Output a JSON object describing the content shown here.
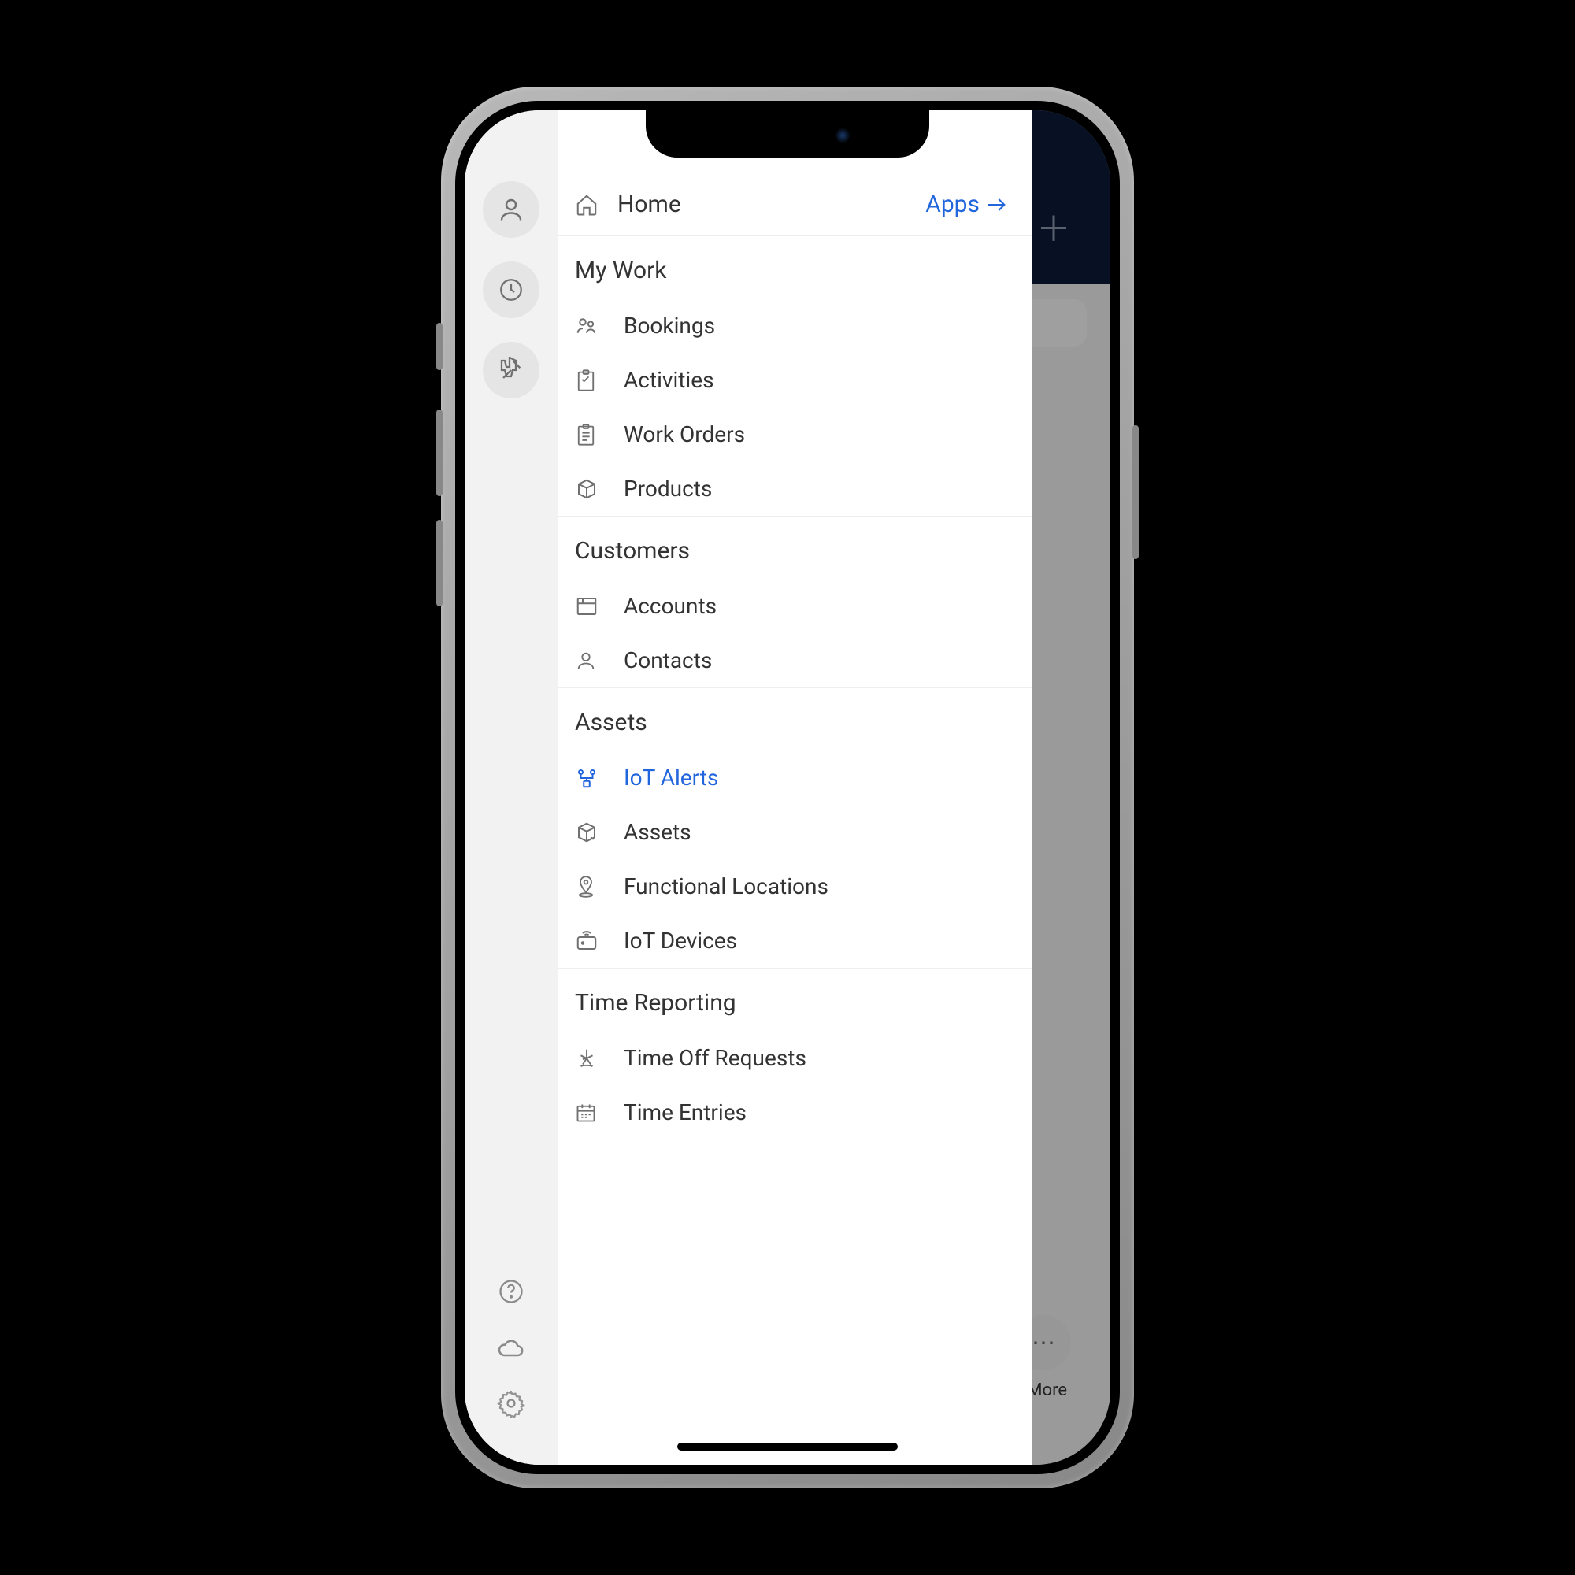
{
  "home": {
    "label": "Home",
    "apps_label": "Apps"
  },
  "sections": [
    {
      "title": "My Work",
      "items": [
        {
          "label": "Bookings"
        },
        {
          "label": "Activities"
        },
        {
          "label": "Work Orders"
        },
        {
          "label": "Products"
        }
      ]
    },
    {
      "title": "Customers",
      "items": [
        {
          "label": "Accounts"
        },
        {
          "label": "Contacts"
        }
      ]
    },
    {
      "title": "Assets",
      "items": [
        {
          "label": "IoT Alerts",
          "active": true
        },
        {
          "label": "Assets"
        },
        {
          "label": "Functional Locations"
        },
        {
          "label": "IoT Devices"
        }
      ]
    },
    {
      "title": "Time Reporting",
      "items": [
        {
          "label": "Time Off Requests"
        },
        {
          "label": "Time Entries"
        }
      ]
    }
  ],
  "bg": {
    "more_label": "More"
  }
}
